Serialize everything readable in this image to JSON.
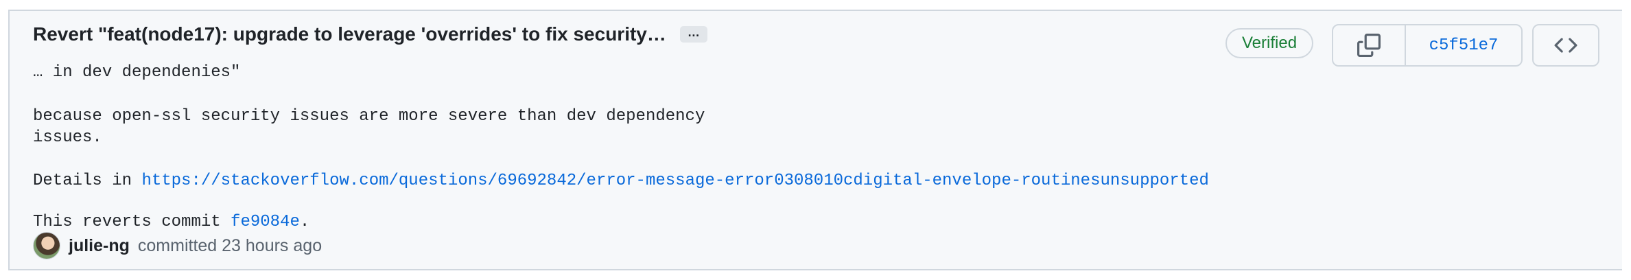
{
  "commit": {
    "title": "Revert \"feat(node17): upgrade to leverage 'overrides' to fix security…",
    "expand_label": "…",
    "body_line1": "… in dev dependenies\"",
    "body_line2": "because open-ssl security issues are more severe than dev dependency",
    "body_line3": "issues.",
    "details_prefix": "Details in ",
    "details_link": "https://stackoverflow.com/questions/69692842/error-message-error0308010cdigital-envelope-routinesunsupported",
    "reverts_prefix": "This reverts commit ",
    "reverts_link": "fe9084e",
    "reverts_suffix": ".",
    "author": "julie-ng",
    "meta": "committed 23 hours ago",
    "verified_label": "Verified",
    "sha": "c5f51e7"
  },
  "icons": {
    "copy": "copy-icon",
    "browse": "code-icon",
    "avatar": "avatar"
  },
  "colors": {
    "link": "#0969da",
    "verified": "#1a7f37",
    "background": "#f6f8fa",
    "border": "#d0d7de"
  }
}
